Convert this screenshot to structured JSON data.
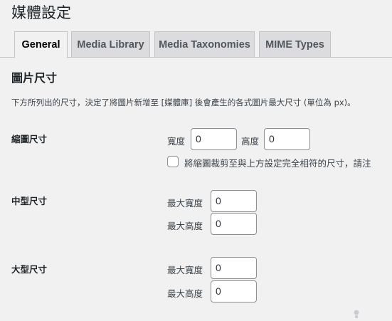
{
  "page": {
    "title": "媒體設定"
  },
  "tabs": [
    {
      "label": "General",
      "active": true
    },
    {
      "label": "Media Library",
      "active": false
    },
    {
      "label": "Media Taxonomies",
      "active": false
    },
    {
      "label": "MIME Types",
      "active": false
    }
  ],
  "image_sizes": {
    "heading": "圖片尺寸",
    "description": "下方所列出的尺寸，決定了將圖片新增至 [媒體庫] 後會產生的各式圖片最大尺寸 (單位為 px)。",
    "thumbnail": {
      "label": "縮圖尺寸",
      "width_label": "寬度",
      "width_value": "0",
      "height_label": "高度",
      "height_value": "0",
      "crop_label": "將縮圖裁剪至與上方設定完全相符的尺寸，請注",
      "crop_checked": false
    },
    "medium": {
      "label": "中型尺寸",
      "max_width_label": "最大寬度",
      "max_width_value": "0",
      "max_height_label": "最大高度",
      "max_height_value": "0"
    },
    "large": {
      "label": "大型尺寸",
      "max_width_label": "最大寬度",
      "max_width_value": "0",
      "max_height_label": "最大高度",
      "max_height_value": "0"
    }
  },
  "colors": {
    "background": "#f1f1f1",
    "tab_inactive": "#dcdcde",
    "border": "#c3c4c7",
    "input_border": "#8c8f94"
  }
}
